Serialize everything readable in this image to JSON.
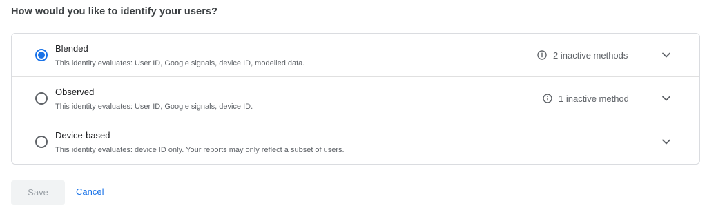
{
  "question": "How would you like to identify your users?",
  "options": [
    {
      "title": "Blended",
      "description": "This identity evaluates: User ID, Google signals, device ID, modelled data.",
      "inactive_text": "2 inactive methods",
      "selected": true,
      "icons": {
        "info": "info-icon",
        "expand": "chevron-down-icon"
      }
    },
    {
      "title": "Observed",
      "description": "This identity evaluates: User ID, Google signals, device ID.",
      "inactive_text": "1 inactive method",
      "selected": false,
      "icons": {
        "info": "info-icon",
        "expand": "chevron-down-icon"
      }
    },
    {
      "title": "Device-based",
      "description": "This identity evaluates: device ID only. Your reports may only reflect a subset of users.",
      "inactive_text": "",
      "selected": false,
      "icons": {
        "expand": "chevron-down-icon"
      }
    }
  ],
  "actions": {
    "save_label": "Save",
    "save_disabled": true,
    "cancel_label": "Cancel"
  },
  "colors": {
    "accent": "#1a73e8",
    "text_primary": "#202124",
    "text_secondary": "#5f6368",
    "border": "#dadce0",
    "disabled_bg": "#f1f3f4",
    "disabled_text": "#9aa0a6"
  }
}
